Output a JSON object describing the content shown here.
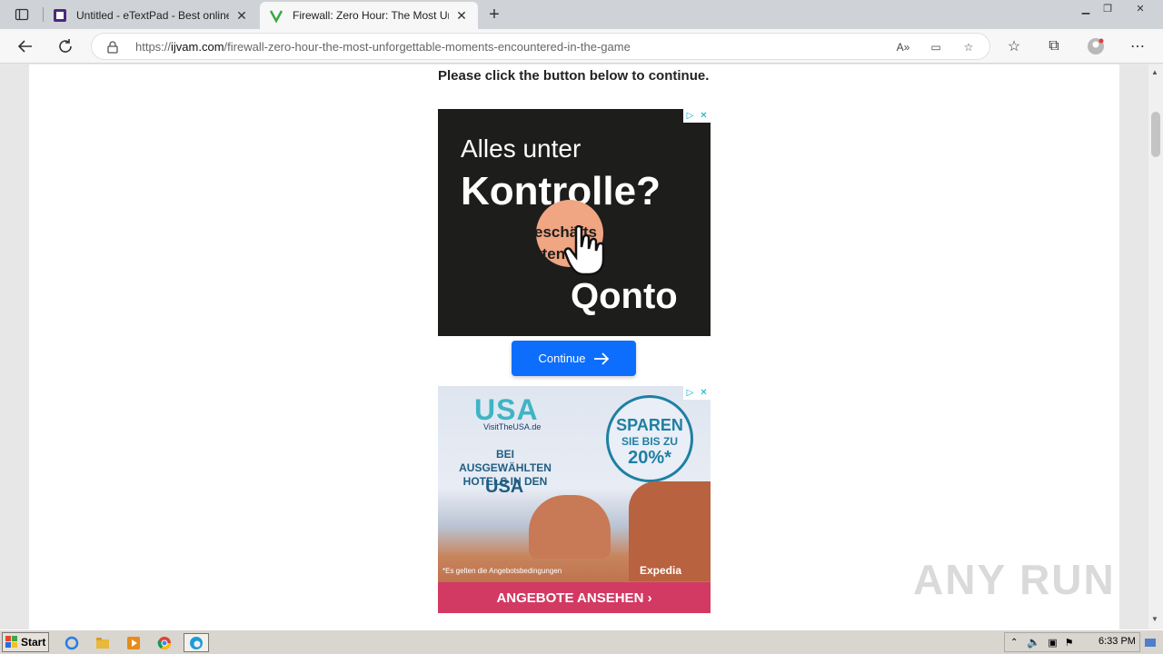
{
  "browser": {
    "tabs": [
      {
        "title": "Untitled - eTextPad - Best online T",
        "active": false
      },
      {
        "title": "Firewall: Zero Hour: The Most Un",
        "active": true
      }
    ],
    "url_scheme": "https://",
    "url_domain": "ijvam.com",
    "url_path": "/firewall-zero-hour-the-most-unforgettable-moments-encountered-in-the-game"
  },
  "page": {
    "instruction": "Please click the button below to continue.",
    "continue_label": "Continue"
  },
  "ad1": {
    "line1": "Alles unter",
    "line2": "Kontrolle?",
    "pill_text_1": "eschäfts",
    "pill_text_2": "rten",
    "brand": "Qonto"
  },
  "ad2": {
    "logo": "USA",
    "logo_sub": "VisitTheUSA.de",
    "badge_1": "SPAREN",
    "badge_2": "SIE BIS ZU",
    "badge_3": "20%*",
    "headline": "BEI AUSGEWÄHLTEN HOTELS IN DEN",
    "country": "USA",
    "fine_print": "*Es gelten die Angebotsbedingungen",
    "partner": "Expedia",
    "cta": "ANGEBOTE ANSEHEN ›"
  },
  "watermark": "ANY RUN",
  "taskbar": {
    "start_label": "Start",
    "clock": "6:33 PM"
  },
  "colors": {
    "continue_bg": "#0d6efd",
    "ad_cta": "#d23a63",
    "ad1_bg": "#1d1d1b",
    "pill": "#f0a583"
  }
}
